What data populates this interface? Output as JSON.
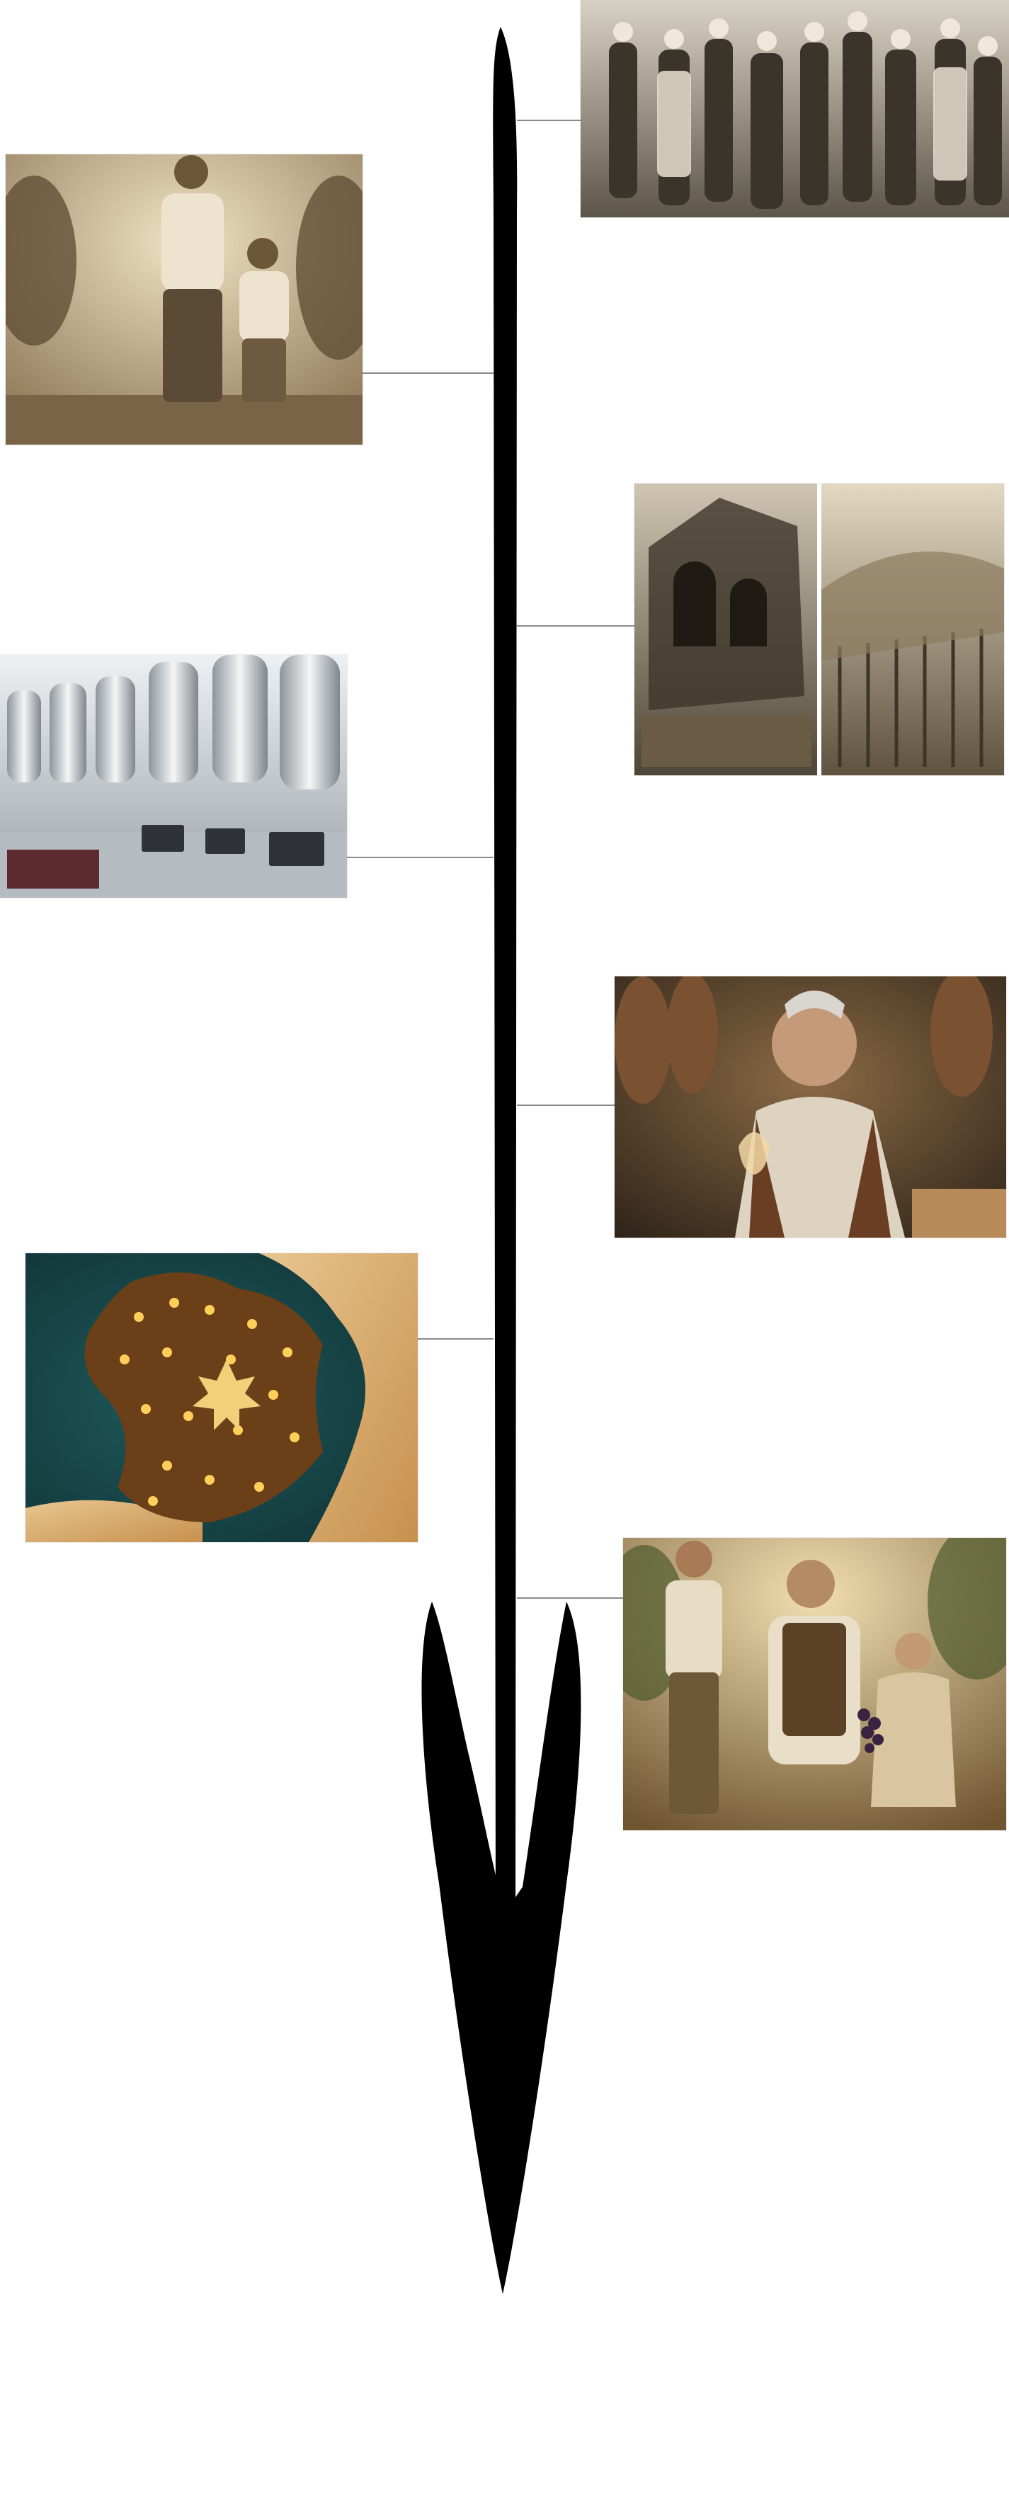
{
  "timeline": {
    "arrow_color": "#000000",
    "connector_color": "#8a8a8a",
    "direction": "down"
  },
  "entries": [
    {
      "side": "right",
      "image": "vintage-family-in-vineyard-photo",
      "palette": "sepia"
    },
    {
      "side": "left",
      "image": "father-and-son-pruning-vines-photo",
      "palette": "sepia"
    },
    {
      "side": "right",
      "image": "stone-cellar-and-hillside-vineyard-diptych",
      "palette": "sepia"
    },
    {
      "side": "left",
      "image": "modern-stainless-steel-winery-photo",
      "palette": "steel-gray"
    },
    {
      "side": "right",
      "image": "winemaker-tasting-in-barrel-cellar-photo",
      "palette": "warm"
    },
    {
      "side": "left",
      "image": "glowing-map-of-france-wine-regions",
      "palette": "teal-gold"
    },
    {
      "side": "right",
      "image": "grandfather-and-children-with-grapes-photo",
      "palette": "sepia-warm"
    }
  ]
}
